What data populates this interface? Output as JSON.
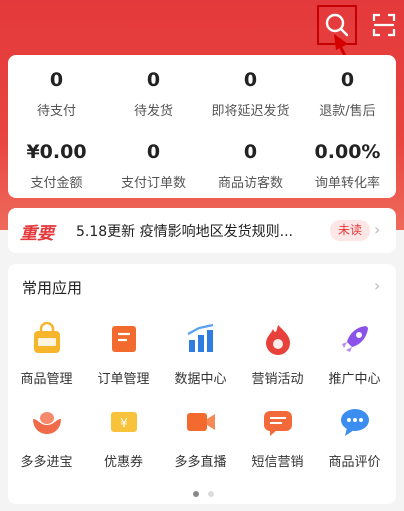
{
  "colors": {
    "brand_red": "#e4393c",
    "text_dark": "#222222",
    "text_muted": "#555555",
    "badge_bg": "#fde6e6"
  },
  "header": {
    "search_icon": "search-icon",
    "scan_icon": "scan-icon"
  },
  "stats": {
    "row1": [
      {
        "value": "0",
        "label": "待支付"
      },
      {
        "value": "0",
        "label": "待发货"
      },
      {
        "value": "0",
        "label": "即将延迟发货"
      },
      {
        "value": "0",
        "label": "退款/售后"
      }
    ],
    "row2": [
      {
        "value": "¥0.00",
        "label": "支付金额"
      },
      {
        "value": "0",
        "label": "支付订单数"
      },
      {
        "value": "0",
        "label": "商品访客数"
      },
      {
        "value": "0.00%",
        "label": "询单转化率"
      }
    ]
  },
  "notice": {
    "tag": "重要",
    "text": "5.18更新 疫情影响地区发货规则...",
    "badge": "未读"
  },
  "apps": {
    "title": "常用应用",
    "items": [
      {
        "label": "商品管理",
        "icon": "goods-bag-icon"
      },
      {
        "label": "订单管理",
        "icon": "order-scroll-icon"
      },
      {
        "label": "数据中心",
        "icon": "data-chart-icon"
      },
      {
        "label": "营销活动",
        "icon": "marketing-fire-icon"
      },
      {
        "label": "推广中心",
        "icon": "promotion-rocket-icon"
      },
      {
        "label": "多多进宝",
        "icon": "treasure-ingot-icon"
      },
      {
        "label": "优惠券",
        "icon": "coupon-ticket-icon"
      },
      {
        "label": "多多直播",
        "icon": "live-video-icon"
      },
      {
        "label": "短信营销",
        "icon": "sms-message-icon"
      },
      {
        "label": "商品评价",
        "icon": "review-chat-icon"
      }
    ]
  }
}
